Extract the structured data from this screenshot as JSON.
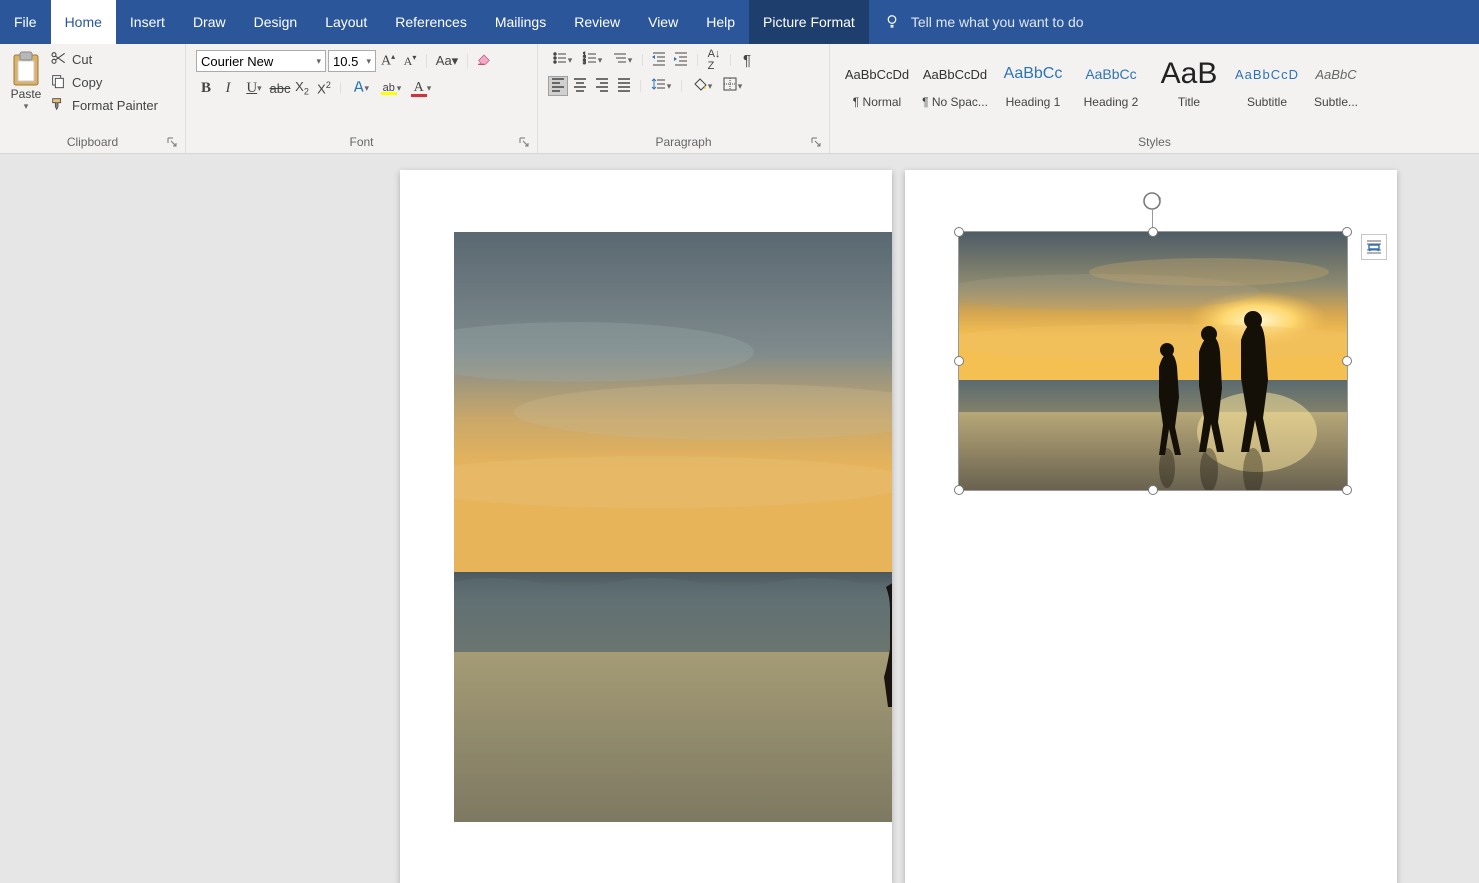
{
  "tabs": {
    "file": "File",
    "home": "Home",
    "insert": "Insert",
    "draw": "Draw",
    "design": "Design",
    "layout": "Layout",
    "references": "References",
    "mailings": "Mailings",
    "review": "Review",
    "view": "View",
    "help": "Help",
    "picture_format": "Picture Format"
  },
  "tellme": {
    "placeholder": "Tell me what you want to do"
  },
  "clipboard": {
    "paste": "Paste",
    "cut": "Cut",
    "copy": "Copy",
    "format_painter": "Format Painter",
    "group_label": "Clipboard"
  },
  "font": {
    "name": "Courier New",
    "size": "10.5",
    "group_label": "Font"
  },
  "paragraph": {
    "group_label": "Paragraph"
  },
  "styles": {
    "group_label": "Styles",
    "preview": "AaBbCcDd",
    "preview_head": "AaBbCc",
    "preview_title": "AaB",
    "preview_sub": "AaBbCcD",
    "preview_subtle": "AaBbC",
    "items": [
      {
        "name": "¶ Normal"
      },
      {
        "name": "¶ No Spac..."
      },
      {
        "name": "Heading 1"
      },
      {
        "name": "Heading 2"
      },
      {
        "name": "Title"
      },
      {
        "name": "Subtitle"
      },
      {
        "name": "Subtle..."
      }
    ]
  }
}
